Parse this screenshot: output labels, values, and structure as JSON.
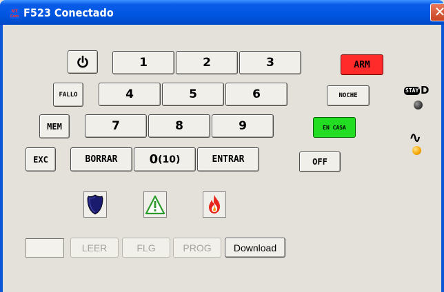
{
  "window": {
    "title": "F523 Conectado",
    "icon": "nt-com-logo-icon",
    "icon_text": "NT Com",
    "close_label": "✕"
  },
  "keypad": {
    "power_icon": "power-icon",
    "power_symbol": "⏻",
    "keys": {
      "k1": "1",
      "k2": "2",
      "k3": "3",
      "k4": "4",
      "k5": "5",
      "k6": "6",
      "k7": "7",
      "k8": "8",
      "k9": "9",
      "k0": "0",
      "k0_suffix": "(10)"
    },
    "fallo": "FALLO",
    "mem": "MEM",
    "exc": "EXC",
    "borrar": "BORRAR",
    "entrar": "ENTRAR"
  },
  "modes": {
    "arm": "ARM",
    "noche": "NOCHE",
    "en_casa": "EN CASA",
    "off": "OFF"
  },
  "colors": {
    "arm": "#ff2b2b",
    "en_casa": "#22dd22",
    "stay_led": "#3c3c3c",
    "ac_led": "#f5a500",
    "police": "#1a1a6e",
    "fire": "#e8251c",
    "alert": "#2a9a2a"
  },
  "emergency": {
    "police_icon": "police-shield-icon",
    "alert_icon": "warning-triangle-icon",
    "fire_icon": "fire-icon"
  },
  "indicators": {
    "stay_badge": "STAY",
    "stay_letter": "D",
    "stay_led_state": "off",
    "ac_symbol": "∿",
    "ac_led_state": "on"
  },
  "footer": {
    "status_value": "",
    "leer": "LEER",
    "flg": "FLG",
    "prog": "PROG",
    "download": "Download"
  }
}
